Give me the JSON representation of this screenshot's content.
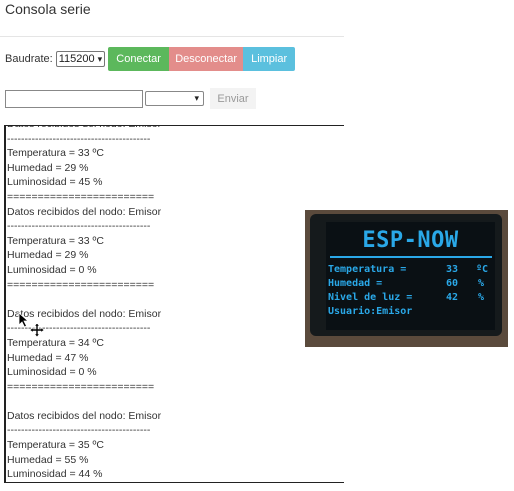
{
  "page": {
    "title": "Consola serie"
  },
  "toolbar": {
    "baudrate_label": "Baudrate:",
    "baudrate_value": "115200",
    "connect_label": "Conectar",
    "disconnect_label": "Desconectar",
    "clear_label": "Limpiar"
  },
  "send": {
    "input_value": "",
    "node_select_value": "",
    "send_label": "Enviar"
  },
  "console": {
    "lines": [
      "Datos recibidos del nodo:  Emisor",
      "-----------------------------------------",
      "Temperatura = 33 ºC",
      "Humedad = 29 %",
      "Luminosidad = 45 %",
      "========================",
      "Datos recibidos del nodo:  Emisor",
      "-----------------------------------------",
      "Temperatura = 33 ºC",
      "Humedad = 29 %",
      "Luminosidad = 0 %",
      "========================",
      "",
      "Datos recibidos del nodo:  Emisor",
      "-----------------------------------------",
      "Temperatura = 34 ºC",
      "Humedad = 47 %",
      "Luminosidad = 0 %",
      "========================",
      "",
      "Datos recibidos del nodo:  Emisor",
      "-----------------------------------------",
      "Temperatura = 35 ºC",
      "Humedad = 55 %",
      "Luminosidad = 44 %"
    ]
  },
  "display_photo": {
    "title": "ESP-NOW",
    "rows": [
      {
        "label": "Temperatura =",
        "value": "33",
        "unit": "ºC"
      },
      {
        "label": "Humedad =",
        "value": "60",
        "unit": "%"
      },
      {
        "label": "Nivel de luz =",
        "value": "42",
        "unit": "%"
      }
    ],
    "footer": "Usuario:Emisor",
    "accent_color": "#2aa8e8"
  },
  "colors": {
    "connect": "#5cb85c",
    "disconnect": "#e38d8b",
    "clear": "#5bc0de"
  }
}
